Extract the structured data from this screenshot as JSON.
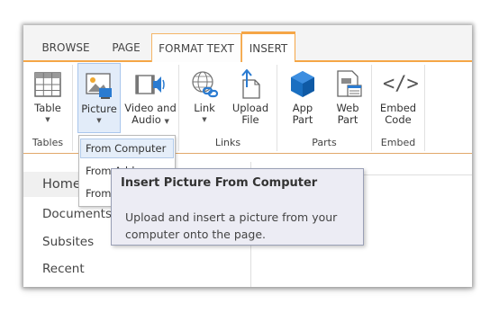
{
  "tabs": [
    {
      "label": "BROWSE"
    },
    {
      "label": "PAGE"
    },
    {
      "label": "FORMAT TEXT"
    },
    {
      "label": "INSERT"
    }
  ],
  "ribbon": {
    "groups": [
      {
        "label": "Tables",
        "buttons": [
          {
            "label": "Table",
            "has_arrow": true
          }
        ]
      },
      {
        "label": "",
        "buttons": [
          {
            "label": "Picture",
            "has_arrow": true,
            "pressed": true
          },
          {
            "label_line1": "Video and",
            "label_line2": "Audio",
            "has_arrow": true
          }
        ]
      },
      {
        "label": "Links",
        "buttons": [
          {
            "label": "Link",
            "has_arrow": true
          },
          {
            "label_line1": "Upload",
            "label_line2": "File"
          }
        ]
      },
      {
        "label": "Parts",
        "buttons": [
          {
            "label_line1": "App",
            "label_line2": "Part"
          },
          {
            "label_line1": "Web",
            "label_line2": "Part"
          }
        ]
      },
      {
        "label": "Embed",
        "buttons": [
          {
            "label_line1": "Embed",
            "label_line2": "Code",
            "icon_text": "</>"
          }
        ]
      }
    ],
    "arrow_glyph": "▼"
  },
  "picture_menu": {
    "items": [
      {
        "label": "From Computer",
        "hover": true
      },
      {
        "label": "From Address"
      },
      {
        "label": "From SharePoint"
      }
    ]
  },
  "tooltip": {
    "title": "Insert Picture From Computer",
    "body": "Upload and insert a picture from your computer onto the page."
  },
  "quick_launch": {
    "items": [
      {
        "label": "Home",
        "selected": true
      },
      {
        "label": "Documents"
      },
      {
        "label": "Subsites"
      },
      {
        "label": "Recent"
      }
    ]
  },
  "colors": {
    "accent": "#f5a646",
    "app_part_blue": "#1a6fc1",
    "link_blue": "#2a7bd1"
  },
  "icons": [
    "table-icon",
    "picture-icon",
    "video-audio-icon",
    "link-icon",
    "upload-file-icon",
    "app-part-icon",
    "web-part-icon",
    "embed-code-icon"
  ]
}
